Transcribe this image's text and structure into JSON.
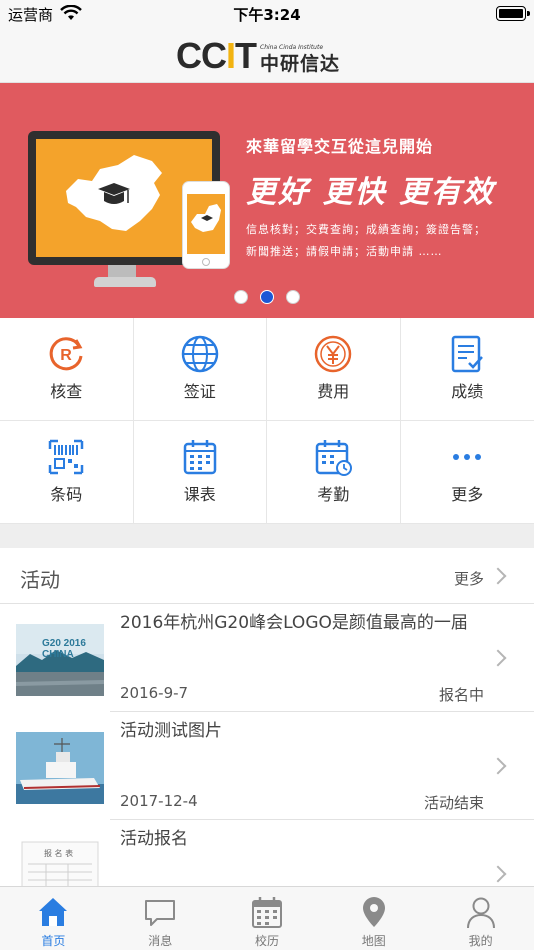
{
  "status_bar": {
    "carrier": "运营商",
    "time": "下午3:24"
  },
  "header": {
    "logo_main": "CCIT",
    "logo_en": "China Cinda Institute",
    "logo_cn": "中研信达"
  },
  "banner": {
    "slogan_line1": "來華留學交互從這兒開始",
    "slogan_line2": "更好 更快 更有效",
    "slogan_line3": "信息核對；交費查詢；成績查詢；簽證告警；",
    "slogan_line4": "新聞推送；請假申請；活動申請 ……",
    "page_count": 3,
    "active_page": 2
  },
  "functions": [
    {
      "label": "核查",
      "icon": "verify-icon"
    },
    {
      "label": "签证",
      "icon": "visa-globe-icon"
    },
    {
      "label": "费用",
      "icon": "fee-yen-icon"
    },
    {
      "label": "成绩",
      "icon": "grades-icon"
    },
    {
      "label": "条码",
      "icon": "barcode-icon"
    },
    {
      "label": "课表",
      "icon": "timetable-icon"
    },
    {
      "label": "考勤",
      "icon": "attendance-icon"
    },
    {
      "label": "更多",
      "icon": "more-icon"
    }
  ],
  "activities": {
    "title": "活动",
    "more_label": "更多",
    "items": [
      {
        "name": "2016年杭州G20峰会LOGO是颜值最高的一届",
        "date": "2016-9-7",
        "status": "报名中",
        "thumb_text": "G20 2016 CHINA"
      },
      {
        "name": "活动测试图片",
        "date": "2017-12-4",
        "status": "活动结束"
      },
      {
        "name": "活动报名",
        "thumb_text": "报 名 表"
      }
    ]
  },
  "tabbar": {
    "tabs": [
      {
        "label": "首页",
        "icon": "home-icon",
        "active": true
      },
      {
        "label": "消息",
        "icon": "message-icon",
        "active": false
      },
      {
        "label": "校历",
        "icon": "calendar-icon",
        "active": false
      },
      {
        "label": "地图",
        "icon": "map-pin-icon",
        "active": false
      },
      {
        "label": "我的",
        "icon": "profile-icon",
        "active": false
      }
    ]
  },
  "colors": {
    "accent": "#2a7de1",
    "banner_bg": "#e05a5f",
    "icon_orange": "#e8642c"
  }
}
